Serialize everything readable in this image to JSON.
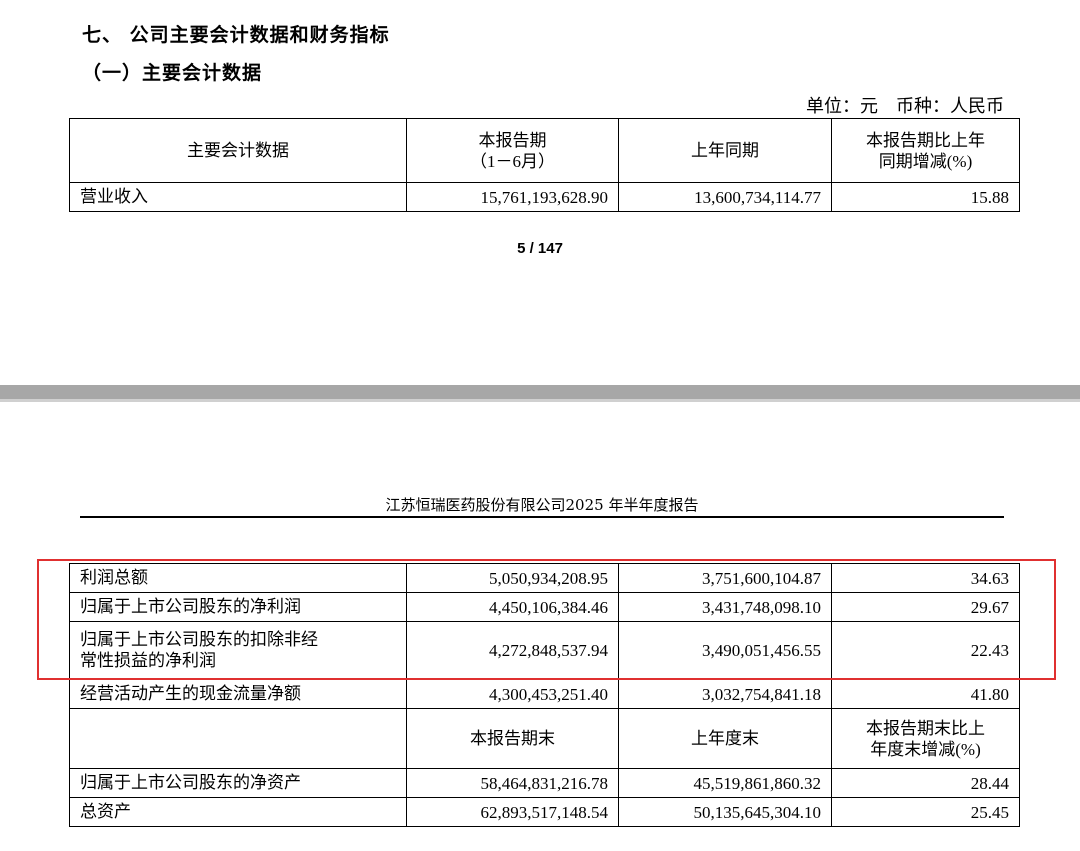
{
  "section": {
    "heading": "七、 公司主要会计数据和财务指标",
    "subheading": "（一）主要会计数据",
    "unit_line": "单位：元　币种：人民币"
  },
  "table1": {
    "header": {
      "col1": "主要会计数据",
      "col2_line1": "本报告期",
      "col2_line2": "（1－6月）",
      "col3": "上年同期",
      "col4_line1": "本报告期比上年",
      "col4_line2": "同期增减(%)"
    },
    "rows": [
      {
        "label": "营业收入",
        "current": "15,761,193,628.90",
        "prior": "13,600,734,114.77",
        "change": "15.88"
      }
    ]
  },
  "page_number": "5 / 147",
  "report_header": "江苏恒瑞医药股份有限公司2025 年半年度报告",
  "table2": {
    "rows": [
      {
        "label": "利润总额",
        "current": "5,050,934,208.95",
        "prior": "3,751,600,104.87",
        "change": "34.63"
      },
      {
        "label": "归属于上市公司股东的净利润",
        "current": "4,450,106,384.46",
        "prior": "3,431,748,098.10",
        "change": "29.67"
      },
      {
        "label_line1": "归属于上市公司股东的扣除非经",
        "label_line2": "常性损益的净利润",
        "current": "4,272,848,537.94",
        "prior": "3,490,051,456.55",
        "change": "22.43"
      },
      {
        "label": "经营活动产生的现金流量净额",
        "current": "4,300,453,251.40",
        "prior": "3,032,754,841.18",
        "change": "41.80"
      }
    ],
    "subheader": {
      "col1": "",
      "col2": "本报告期末",
      "col3": "上年度末",
      "col4_line1": "本报告期末比上",
      "col4_line2": "年度末增减(%)"
    },
    "rows2": [
      {
        "label": "归属于上市公司股东的净资产",
        "current": "58,464,831,216.78",
        "prior": "45,519,861,860.32",
        "change": "28.44"
      },
      {
        "label": "总资产",
        "current": "62,893,517,148.54",
        "prior": "50,135,645,304.10",
        "change": "25.45"
      }
    ]
  },
  "colors": {
    "highlight_border": "#e03030",
    "divider": "#a7a7a7"
  }
}
